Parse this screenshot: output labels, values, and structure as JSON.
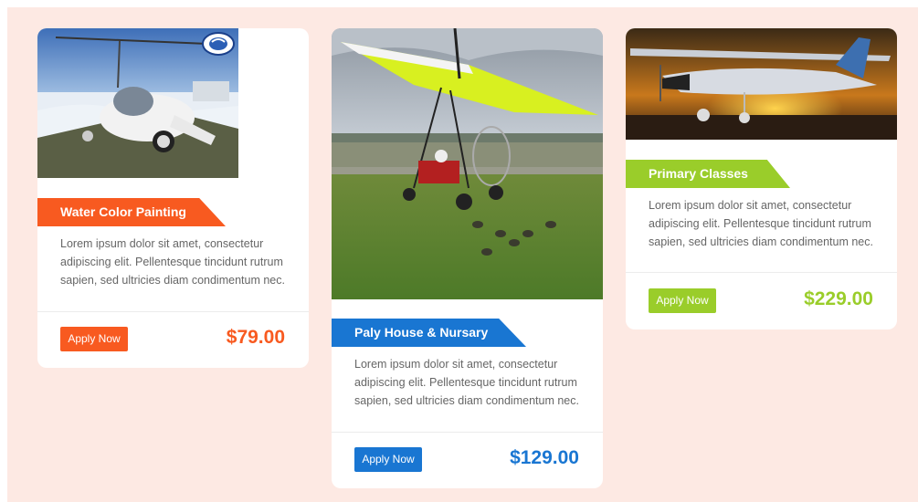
{
  "cards": [
    {
      "image": "gyrocopter-photo",
      "title": "Water Color Painting",
      "description": "Lorem ipsum dolor sit amet, consectetur adipiscing elit. Pellentesque tincidunt rutrum sapien, sed ultricies diam condimentum nec.",
      "button_label": "Apply Now",
      "price": "$79.00",
      "accent_color": "#f85a20"
    },
    {
      "image": "ultralight-trike-photo",
      "title": "Paly House & Nursary",
      "description": "Lorem ipsum dolor sit amet, consectetur adipiscing elit. Pellentesque tincidunt rutrum sapien, sed ultricies diam condimentum nec.",
      "button_label": "Apply Now",
      "price": "$129.00",
      "accent_color": "#1976d2"
    },
    {
      "image": "sunset-airplane-photo",
      "title": "Primary Classes",
      "description": "Lorem ipsum dolor sit amet, consectetur adipiscing elit. Pellentesque tincidunt rutrum sapien, sed ultricies diam condimentum nec.",
      "button_label": "Apply Now",
      "price": "$229.00",
      "accent_color": "#9acd2a"
    }
  ],
  "background_color": "#fde9e3"
}
